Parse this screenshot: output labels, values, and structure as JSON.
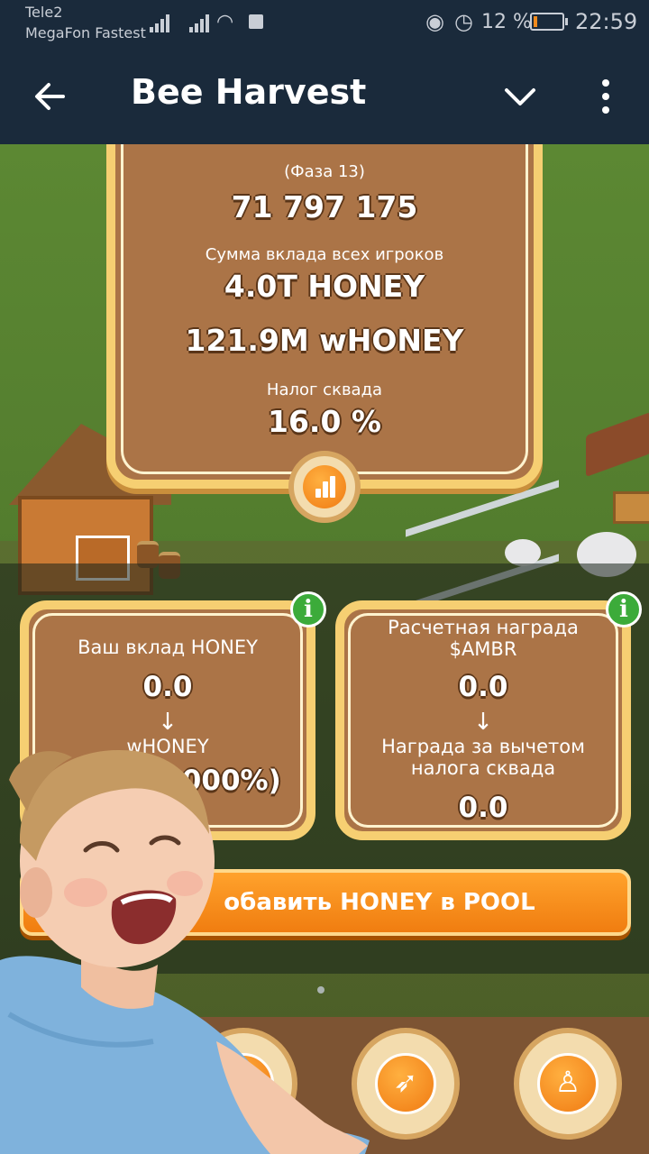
{
  "status_bar": {
    "carrier_1": "Tele2",
    "carrier_2": "MegaFon Fastest",
    "battery_percent": "12 %",
    "battery_level": 0.12,
    "time": "22:59",
    "icons": [
      "signal-icon",
      "signal-icon",
      "wifi-icon",
      "notification-square-icon",
      "eye-icon",
      "alarm-icon",
      "battery-icon"
    ]
  },
  "app_bar": {
    "title": "Bee Harvest",
    "icons": [
      "back-arrow-icon",
      "chevron-down-icon",
      "more-vertical-icon"
    ]
  },
  "stats_panel": {
    "phase": "(Фаза 13)",
    "total": "71 797 175",
    "sum_label": "Сумма вклада всех игроков",
    "honey_total": "4.0T HONEY",
    "whoney_total": "121.9M wHONEY",
    "tax_label": "Налог сквада",
    "tax_value": "16.0 %",
    "stats_button_icon": "bar-chart-icon"
  },
  "card_contribution": {
    "title": "Ваш вклад HONEY",
    "value": "0.0",
    "arrow": "↓",
    "subtitle": "wHONEY",
    "sub_value": "0000%)"
  },
  "card_reward": {
    "title": "Расчетная награда $AMBR",
    "value": "0.0",
    "arrow": "↓",
    "subtitle": "Награда за вычетом налога сквада",
    "sub_value": "0.0"
  },
  "info_badge": "i",
  "pool_button": {
    "label": "обавить HONEY в POOL"
  },
  "bottom_nav": [
    {
      "name": "nav-button-left",
      "icon": "hidden-icon"
    },
    {
      "name": "nav-button-rocket",
      "icon": "rocket-icon"
    },
    {
      "name": "nav-button-profile",
      "icon": "user-check-icon"
    }
  ],
  "colors": {
    "app_bar": "#1a2a3b",
    "panel_fill": "#ab7447",
    "panel_border": "#f6cf72",
    "accent_orange": "#f07d10",
    "info_green": "#3cab3a"
  }
}
